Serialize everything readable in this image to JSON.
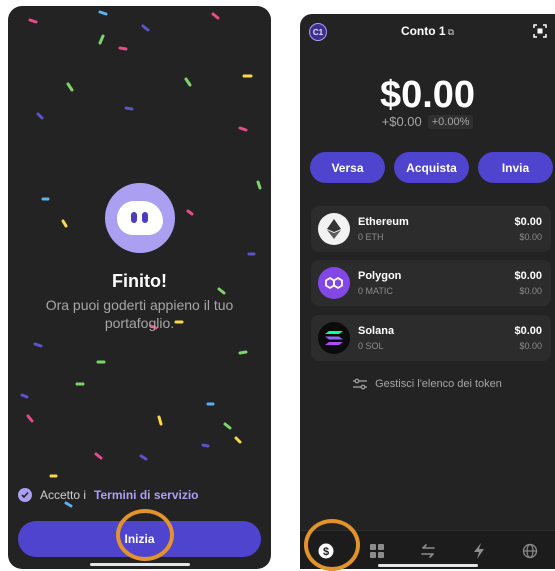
{
  "onboarding": {
    "title": "Finito!",
    "subtitle": "Ora puoi goderti appieno il tuo portafoglio.",
    "terms_prefix": "Accetto i",
    "terms_link": "Termini di servizio",
    "start_button": "Inizia",
    "mascot_icon": "ghost-icon"
  },
  "wallet": {
    "account_badge": "C1",
    "account_name": "Conto 1",
    "balance": "$0.00",
    "change_abs": "+$0.00",
    "change_pct": "+0.00%",
    "actions": [
      "Versa",
      "Acquista",
      "Invia"
    ],
    "tokens": [
      {
        "name": "Ethereum",
        "amount": "0 ETH",
        "value": "$0.00",
        "usd": "$0.00",
        "icon": "ethereum-icon"
      },
      {
        "name": "Polygon",
        "amount": "0 MATIC",
        "value": "$0.00",
        "usd": "$0.00",
        "icon": "polygon-icon"
      },
      {
        "name": "Solana",
        "amount": "0 SOL",
        "value": "$0.00",
        "usd": "$0.00",
        "icon": "solana-icon"
      }
    ],
    "manage_label": "Gestisci l'elenco dei token",
    "tabs": [
      "wallet-icon",
      "collectibles-icon",
      "swap-icon",
      "activity-icon",
      "browser-icon"
    ]
  },
  "colors": {
    "accent": "#ab9ff2",
    "button": "#4e44ce",
    "highlight": "#e2932b",
    "background": "#232323"
  }
}
